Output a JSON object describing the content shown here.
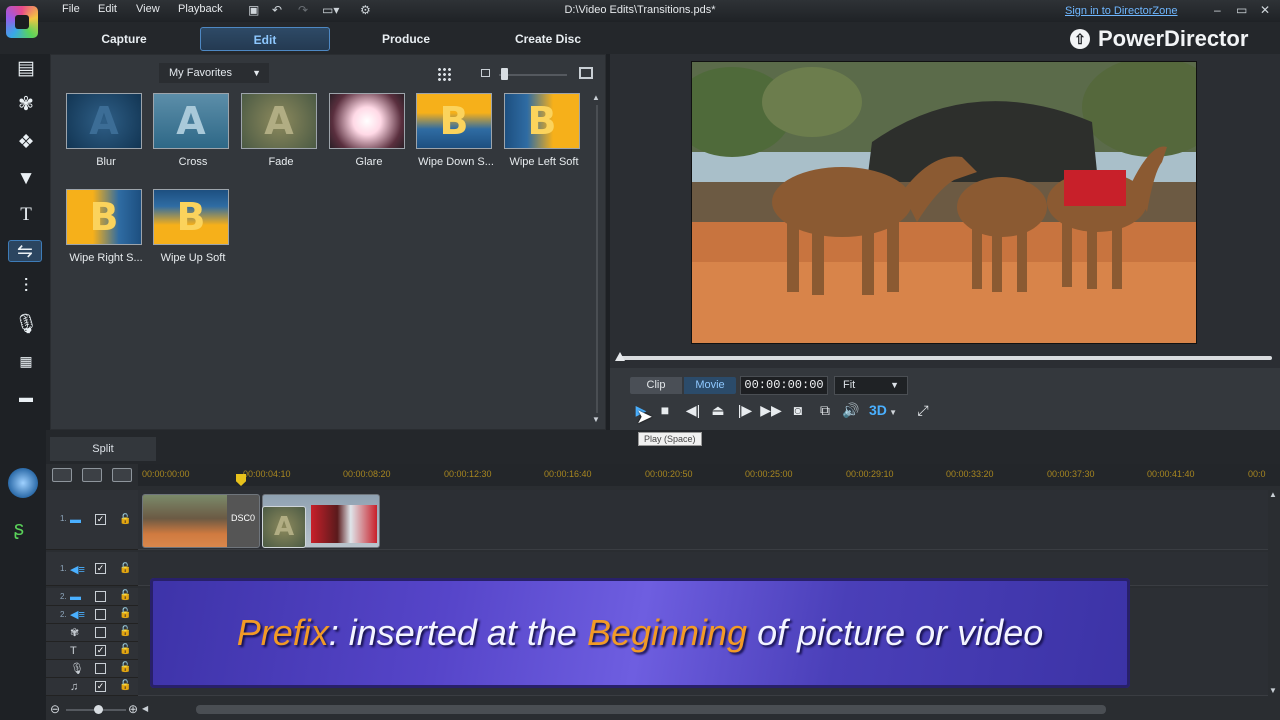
{
  "menu": {
    "items": [
      "File",
      "Edit",
      "View",
      "Playback"
    ]
  },
  "title": {
    "document": "D:\\Video Edits\\Transitions.pds*",
    "signin": "Sign in to DirectorZone",
    "brand": "PowerDirector"
  },
  "modes": {
    "tabs": [
      "Capture",
      "Edit",
      "Produce",
      "Create Disc"
    ],
    "active": "Edit"
  },
  "library": {
    "filter": "My Favorites",
    "items": [
      {
        "label": "Blur",
        "glyph": "A"
      },
      {
        "label": "Cross",
        "glyph": "A"
      },
      {
        "label": "Fade",
        "glyph": "A"
      },
      {
        "label": "Glare",
        "glyph": ""
      },
      {
        "label": "Wipe Down S...",
        "glyph": "B"
      },
      {
        "label": "Wipe Left Soft",
        "glyph": "B"
      },
      {
        "label": "Wipe Right S...",
        "glyph": "B"
      },
      {
        "label": "Wipe Up Soft",
        "glyph": "B"
      }
    ]
  },
  "sidebar": {
    "icons": [
      "capture-icon",
      "media-icon",
      "particle-icon",
      "effect-icon",
      "title-icon",
      "transition-icon",
      "audio-mixer-icon",
      "voice-over-icon",
      "chapter-icon",
      "subtitle-icon"
    ]
  },
  "preview": {
    "modes": [
      "Clip",
      "Movie"
    ],
    "active_mode": "Movie",
    "timecode": "00:00:00:00",
    "fit": "Fit",
    "tooltip": "Play (Space)",
    "stereo_label": "3D",
    "scrub_position": 0
  },
  "timeline": {
    "split_label": "Split",
    "ruler_ticks": [
      "00:00:00:00",
      "00:00:04:10",
      "00:00:08:20",
      "00:00:12:30",
      "00:00:16:40",
      "00:00:20:50",
      "00:00:25:00",
      "00:00:29:10",
      "00:00:33:20",
      "00:00:37:30",
      "00:00:41:40",
      "00:0"
    ],
    "tracks": [
      {
        "num": "1.",
        "type": "video",
        "checked": true
      },
      {
        "num": "1.",
        "type": "audio",
        "checked": true
      },
      {
        "num": "2.",
        "type": "video",
        "checked": false
      },
      {
        "num": "2.",
        "type": "audio",
        "checked": false
      },
      {
        "num": "",
        "type": "effect",
        "checked": false
      },
      {
        "num": "",
        "type": "title",
        "checked": true
      },
      {
        "num": "",
        "type": "voice",
        "checked": false
      },
      {
        "num": "",
        "type": "music",
        "checked": true
      }
    ],
    "clip_label": "DSC0"
  },
  "caption": {
    "word1": "Prefix",
    "rest1": ": inserted at the ",
    "word2": "Beginning",
    "rest2": " of picture or video"
  },
  "colors": {
    "accent": "#4e88c3",
    "highlight": "#f29a26",
    "timeline_ruler": "#a78620"
  }
}
